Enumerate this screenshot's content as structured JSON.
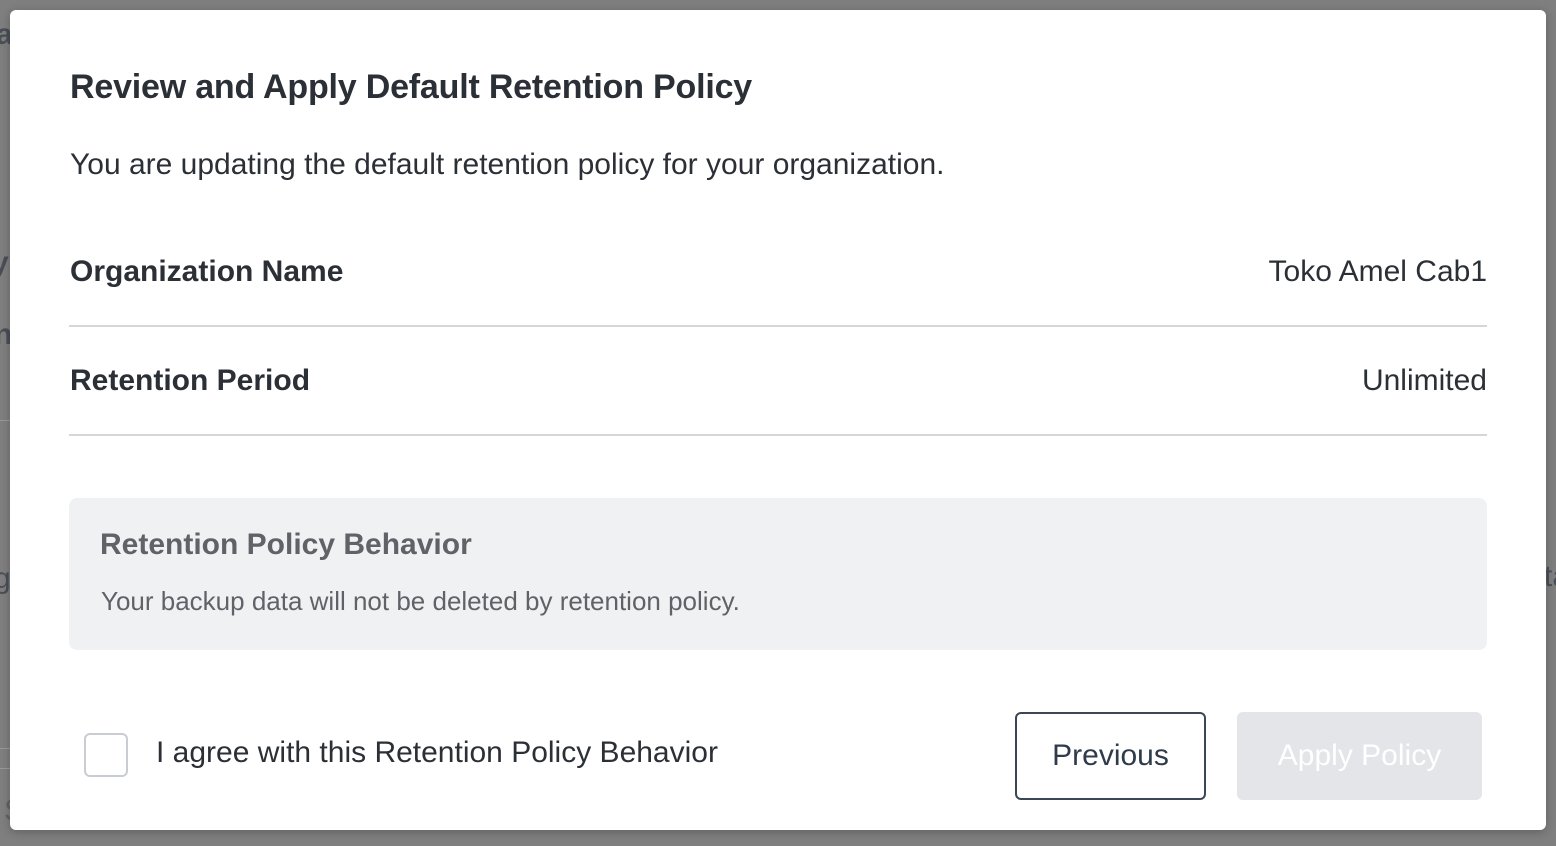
{
  "background": {
    "fragments": [
      "a",
      "y",
      "n",
      "g",
      "ta",
      "S"
    ]
  },
  "dialog": {
    "title": "Review and Apply Default Retention Policy",
    "subtitle": "You are updating the default retention policy for your organization.",
    "details": [
      {
        "label": "Organization Name",
        "value": "Toko Amel Cab1"
      },
      {
        "label": "Retention Period",
        "value": "Unlimited"
      }
    ],
    "behavior": {
      "title": "Retention Policy Behavior",
      "description": "Your backup data will not be deleted by retention policy."
    },
    "agreement": {
      "label": "I agree with this Retention Policy Behavior",
      "checked": false
    },
    "buttons": {
      "previous": "Previous",
      "apply": "Apply Policy"
    }
  },
  "colors": {
    "overlay": "#7f7f7f",
    "text_primary": "#2b2f36",
    "text_muted": "#5f6368",
    "info_box_bg": "#f0f1f3",
    "divider": "#d4d6da",
    "disabled_button_bg": "#e3e5e8"
  }
}
